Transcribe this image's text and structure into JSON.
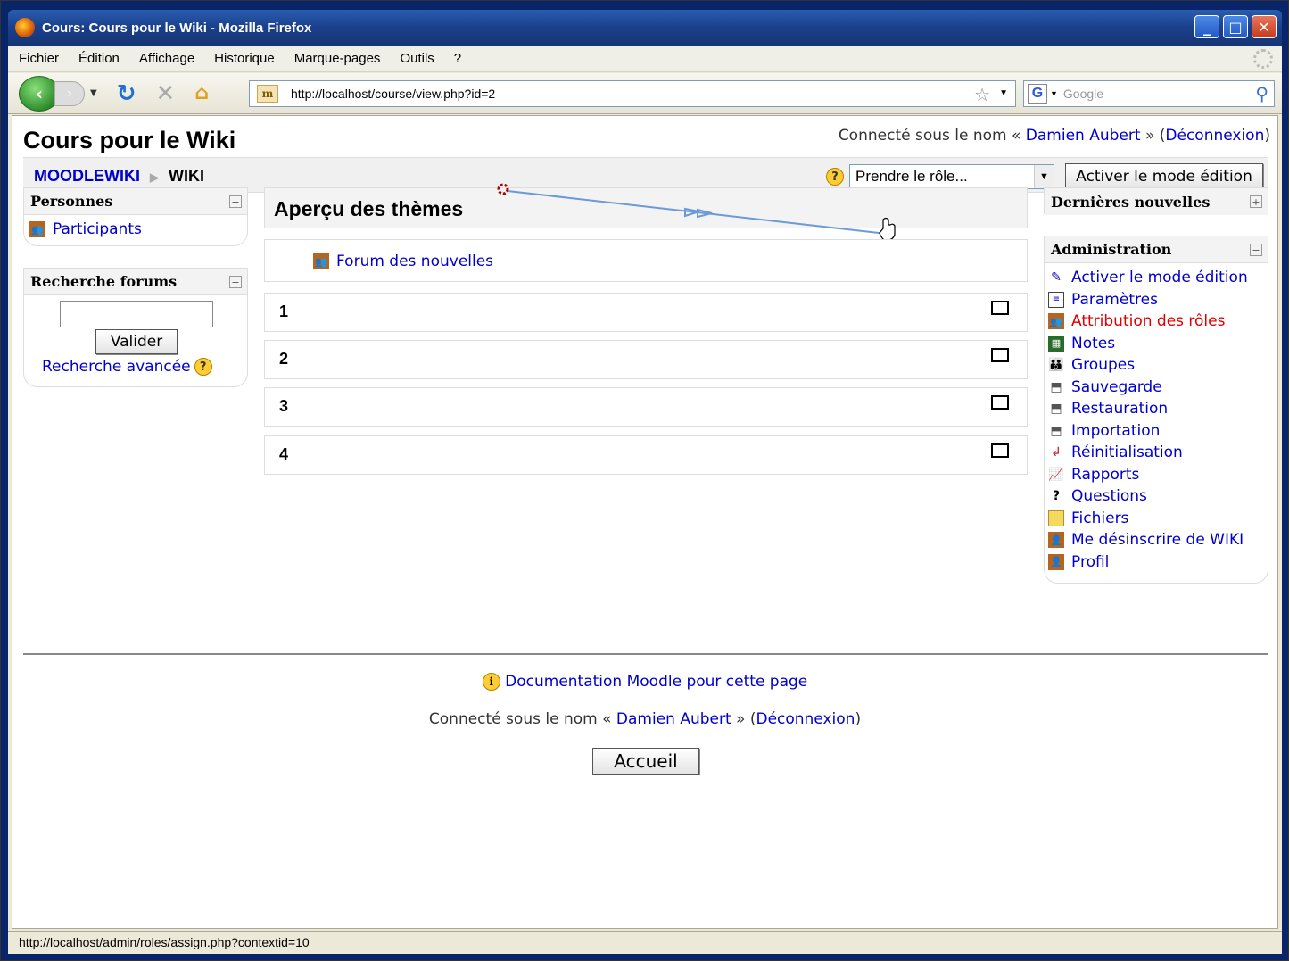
{
  "browser": {
    "title": "Cours: Cours pour le Wiki - Mozilla Firefox",
    "menu": [
      "Fichier",
      "Édition",
      "Affichage",
      "Historique",
      "Marque-pages",
      "Outils",
      "?"
    ],
    "url": "http://localhost/course/view.php?id=2",
    "search_placeholder": "Google",
    "status": "http://localhost/admin/roles/assign.php?contextid=10"
  },
  "page": {
    "title": "Cours pour le Wiki",
    "login_prefix": "Connecté sous le nom «",
    "user": "Damien Aubert",
    "login_mid": "» (",
    "logout": "Déconnexion",
    "login_suffix": ")"
  },
  "breadcrumb": {
    "home": "MOODLEWIKI",
    "current": "WIKI"
  },
  "role_select": {
    "value": "Prendre le rôle..."
  },
  "edit_button": "Activer le mode édition",
  "left": {
    "people": {
      "title": "Personnes",
      "items": [
        "Participants"
      ]
    },
    "search": {
      "title": "Recherche forums",
      "button": "Valider",
      "advanced": "Recherche avancée"
    }
  },
  "main": {
    "heading": "Aperçu des thèmes",
    "forum": "Forum des nouvelles",
    "sections": [
      "1",
      "2",
      "3",
      "4"
    ]
  },
  "right": {
    "news": {
      "title": "Dernières nouvelles"
    },
    "admin": {
      "title": "Administration",
      "items": [
        "Activer le mode édition",
        "Paramètres",
        "Attribution des rôles",
        "Notes",
        "Groupes",
        "Sauvegarde",
        "Restauration",
        "Importation",
        "Réinitialisation",
        "Rapports",
        "Questions",
        "Fichiers",
        "Me désinscrire de WIKI",
        "Profil"
      ],
      "hover_color": "#dd0000"
    }
  },
  "footer": {
    "doc": "Documentation Moodle pour cette page",
    "home_button": "Accueil"
  }
}
